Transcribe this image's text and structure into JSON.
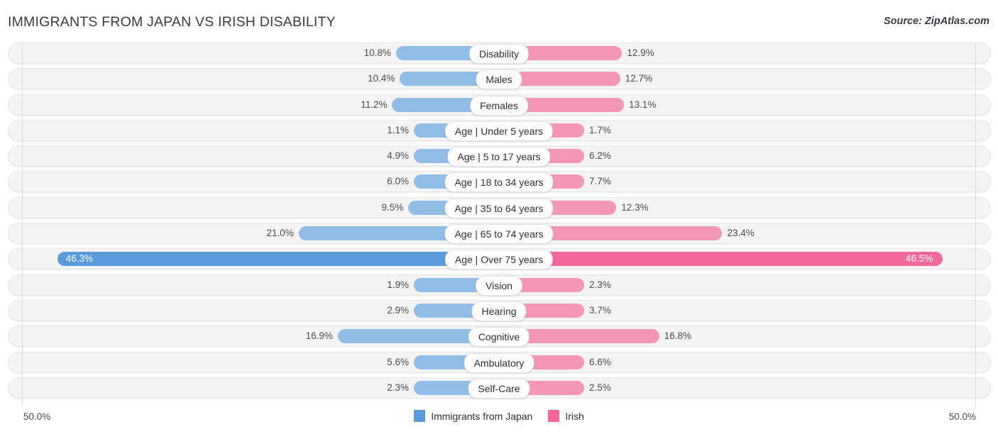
{
  "header": {
    "title": "IMMIGRANTS FROM JAPAN VS IRISH DISABILITY",
    "source": "Source: ZipAtlas.com"
  },
  "axis": {
    "left_label": "50.0%",
    "right_label": "50.0%",
    "max": 50.0
  },
  "legend": [
    {
      "label": "Immigrants from Japan",
      "color": "#5a9bdc"
    },
    {
      "label": "Irish",
      "color": "#f4679d"
    }
  ],
  "colors": {
    "left_bar": "#90bce5",
    "right_bar": "#f497b7",
    "left_bar_highlight": "#5a9bdc",
    "right_bar_highlight": "#f4679d",
    "row_track": "#f4f4f4",
    "gridline": "#d9d9d9"
  },
  "chart_data": {
    "type": "bar",
    "title": "IMMIGRANTS FROM JAPAN VS IRISH DISABILITY",
    "subtitle": "Source: ZipAtlas.com",
    "xlabel": "",
    "ylabel": "",
    "orientation": "horizontal-diverging",
    "xlim": [
      50.0,
      50.0
    ],
    "grid": true,
    "legend_position": "bottom-center",
    "categories": [
      "Disability",
      "Males",
      "Females",
      "Age | Under 5 years",
      "Age | 5 to 17 years",
      "Age | 18 to 34 years",
      "Age | 35 to 64 years",
      "Age | 65 to 74 years",
      "Age | Over 75 years",
      "Vision",
      "Hearing",
      "Cognitive",
      "Ambulatory",
      "Self-Care"
    ],
    "series": [
      {
        "name": "Immigrants from Japan",
        "side": "left",
        "color": "#90bce5",
        "values": [
          10.8,
          10.4,
          11.2,
          1.1,
          4.9,
          6.0,
          9.5,
          21.0,
          46.3,
          1.9,
          2.9,
          16.9,
          5.6,
          2.3
        ],
        "value_labels": [
          "10.8%",
          "10.4%",
          "11.2%",
          "1.1%",
          "4.9%",
          "6.0%",
          "9.5%",
          "21.0%",
          "46.3%",
          "1.9%",
          "2.9%",
          "16.9%",
          "5.6%",
          "2.3%"
        ]
      },
      {
        "name": "Irish",
        "side": "right",
        "color": "#f497b7",
        "values": [
          12.9,
          12.7,
          13.1,
          1.7,
          6.2,
          7.7,
          12.3,
          23.4,
          46.5,
          2.3,
          3.7,
          16.8,
          6.6,
          2.5
        ],
        "value_labels": [
          "12.9%",
          "12.7%",
          "13.1%",
          "1.7%",
          "6.2%",
          "7.7%",
          "12.3%",
          "23.4%",
          "46.5%",
          "2.3%",
          "3.7%",
          "16.8%",
          "6.6%",
          "2.5%"
        ]
      }
    ],
    "highlighted_category": "Age | Over 75 years"
  }
}
